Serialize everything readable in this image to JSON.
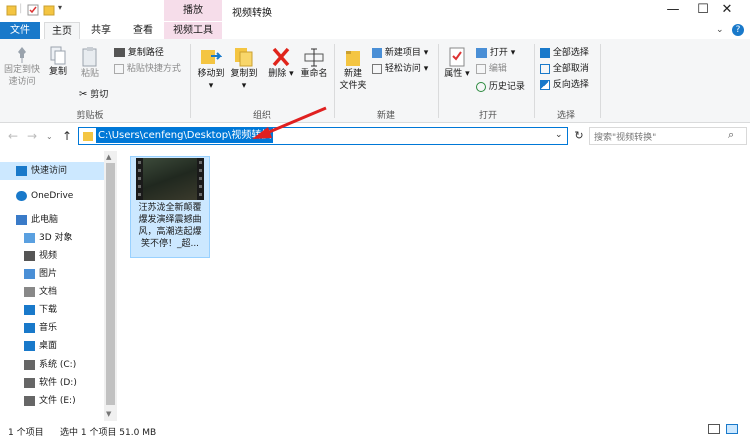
{
  "window": {
    "title": "视频转换",
    "context_tab_group": "播放",
    "minimize": "—",
    "maximize": "☐",
    "close": "✕"
  },
  "tabs": {
    "file": "文件",
    "home": "主页",
    "share": "共享",
    "view": "查看",
    "video_tools": "视频工具"
  },
  "ribbon": {
    "clipboard": {
      "pin_quick_access": [
        "固定到快",
        "速访问"
      ],
      "copy": "复制",
      "paste": "粘贴",
      "copy_path": "复制路径",
      "paste_shortcut": "粘贴快捷方式",
      "cut": "剪切",
      "group_label": "剪贴板"
    },
    "organize": {
      "move_to": "移动到",
      "copy_to": "复制到",
      "delete": "删除",
      "rename": "重命名",
      "group_label": "组织"
    },
    "new": {
      "new_folder": [
        "新建",
        "文件夹"
      ],
      "new_item": "新建项目",
      "easy_access": "轻松访问",
      "group_label": "新建"
    },
    "open": {
      "properties": "属性",
      "open": "打开",
      "edit": "编辑",
      "history": "历史记录",
      "group_label": "打开"
    },
    "select": {
      "select_all": "全部选择",
      "select_none": "全部取消",
      "invert_selection": "反向选择",
      "group_label": "选择"
    }
  },
  "address": {
    "path": "C:\\Users\\cenfeng\\Desktop\\视频转换",
    "search_placeholder": "搜索\"视频转换\""
  },
  "nav_pane": {
    "items": [
      {
        "label": "快速访问",
        "icon": "star-icon",
        "selected": true
      },
      {
        "label": "OneDrive",
        "icon": "cloud-icon",
        "selected": false
      },
      {
        "label": "此电脑",
        "icon": "computer-icon",
        "selected": false
      },
      {
        "label": "3D 对象",
        "icon": "cube-icon",
        "selected": false
      },
      {
        "label": "视频",
        "icon": "video-icon",
        "selected": false
      },
      {
        "label": "图片",
        "icon": "picture-icon",
        "selected": false
      },
      {
        "label": "文档",
        "icon": "document-icon",
        "selected": false
      },
      {
        "label": "下载",
        "icon": "download-icon",
        "selected": false
      },
      {
        "label": "音乐",
        "icon": "music-icon",
        "selected": false
      },
      {
        "label": "桌面",
        "icon": "desktop-icon",
        "selected": false
      },
      {
        "label": "系统 (C:)",
        "icon": "drive-icon",
        "selected": false
      },
      {
        "label": "软件 (D:)",
        "icon": "drive-icon",
        "selected": false
      },
      {
        "label": "文件 (E:)",
        "icon": "drive-icon",
        "selected": false
      }
    ]
  },
  "files": [
    {
      "name_lines": [
        "汪苏泷全新颠覆",
        "爆发演绎震撼曲",
        "风，高潮迭起爆",
        "笑不停！_超..."
      ]
    }
  ],
  "status": {
    "item_count": "1 个项目",
    "selected": "选中 1 个项目  51.0 MB"
  },
  "colors": {
    "accent": "#1979ca",
    "selection": "#cce8ff",
    "context_tab": "#f6ddea",
    "annotation_arrow": "#e02020"
  }
}
